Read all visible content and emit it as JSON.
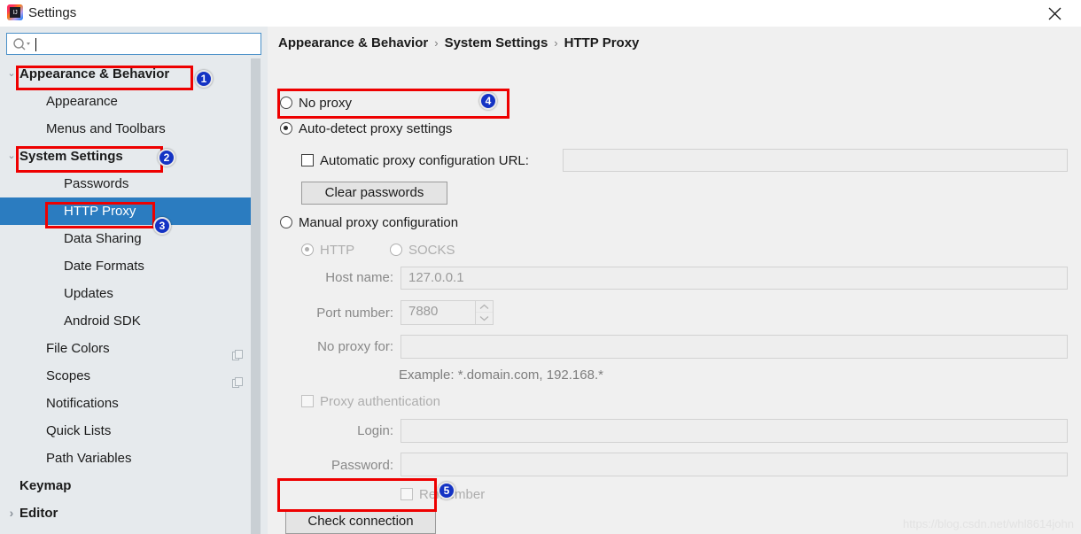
{
  "window": {
    "title": "Settings",
    "app_icon": "intellij-idea-icon",
    "icon_text": "IJ",
    "close_label": "✕"
  },
  "search": {
    "placeholder": "",
    "value": "",
    "icon": "search-icon"
  },
  "sidebar": {
    "items": [
      {
        "label": "Appearance & Behavior",
        "level": 0,
        "chevron": "⌄",
        "expanded": true,
        "selected": false,
        "bold": true
      },
      {
        "label": "Appearance",
        "level": 1,
        "chevron": "",
        "selected": false
      },
      {
        "label": "Menus and Toolbars",
        "level": 1,
        "chevron": "",
        "selected": false
      },
      {
        "label": "System Settings",
        "level": 0,
        "chevron": "⌄",
        "expanded": true,
        "selected": false
      },
      {
        "label": "Passwords",
        "level": 2,
        "chevron": "",
        "selected": false
      },
      {
        "label": "HTTP Proxy",
        "level": 2,
        "chevron": "",
        "selected": true
      },
      {
        "label": "Data Sharing",
        "level": 2,
        "chevron": "",
        "selected": false
      },
      {
        "label": "Date Formats",
        "level": 2,
        "chevron": "",
        "selected": false
      },
      {
        "label": "Updates",
        "level": 2,
        "chevron": "",
        "selected": false
      },
      {
        "label": "Android SDK",
        "level": 2,
        "chevron": "",
        "selected": false
      },
      {
        "label": "File Colors",
        "level": 1,
        "chevron": "",
        "selected": false,
        "trailing_icon": "copy-icon"
      },
      {
        "label": "Scopes",
        "level": 1,
        "chevron": "",
        "selected": false,
        "trailing_icon": "copy-icon"
      },
      {
        "label": "Notifications",
        "level": 1,
        "chevron": "",
        "selected": false
      },
      {
        "label": "Quick Lists",
        "level": 1,
        "chevron": "",
        "selected": false
      },
      {
        "label": "Path Variables",
        "level": 1,
        "chevron": "",
        "selected": false
      },
      {
        "label": "Keymap",
        "level": 0,
        "chevron": "",
        "selected": false,
        "bold": true
      },
      {
        "label": "Editor",
        "level": 0,
        "chevron": "›",
        "expanded": false,
        "selected": false,
        "bold": true
      }
    ]
  },
  "breadcrumb": {
    "part1": "Appearance & Behavior",
    "sep1": "›",
    "part2": "System Settings",
    "sep2": "›",
    "part3": "HTTP Proxy"
  },
  "proxy": {
    "no_proxy_label": "No proxy",
    "no_proxy_checked": false,
    "auto_detect_label": "Auto-detect proxy settings",
    "auto_detect_checked": true,
    "auto_config_url_label": "Automatic proxy configuration URL:",
    "auto_config_url_checked": false,
    "auto_config_url_value": "",
    "clear_passwords_label": "Clear passwords",
    "manual_label": "Manual proxy configuration",
    "manual_checked": false,
    "http_label": "HTTP",
    "http_checked": true,
    "socks_label": "SOCKS",
    "socks_checked": false,
    "host_name_label": "Host name:",
    "host_name_value": "127.0.0.1",
    "port_number_label": "Port number:",
    "port_number_value": "7880",
    "no_proxy_for_label": "No proxy for:",
    "no_proxy_for_value": "",
    "example_hint": "Example: *.domain.com, 192.168.*",
    "proxy_auth_label": "Proxy authentication",
    "proxy_auth_checked": false,
    "login_label": "Login:",
    "login_value": "",
    "password_label": "Password:",
    "password_value": "",
    "remember_label": "Remember",
    "remember_checked": false,
    "check_connection_label": "Check connection"
  },
  "badges": {
    "b1": "1",
    "b2": "2",
    "b3": "3",
    "b4": "4",
    "b5": "5"
  },
  "watermark": "https://blog.csdn.net/whl8614john",
  "colors": {
    "selection_blue": "#2b7cc0",
    "annotation_red": "#ee0000",
    "badge_blue": "#1433c4",
    "sidebar_bg": "#e6eaed",
    "panel_bg": "#f0f0f0"
  }
}
